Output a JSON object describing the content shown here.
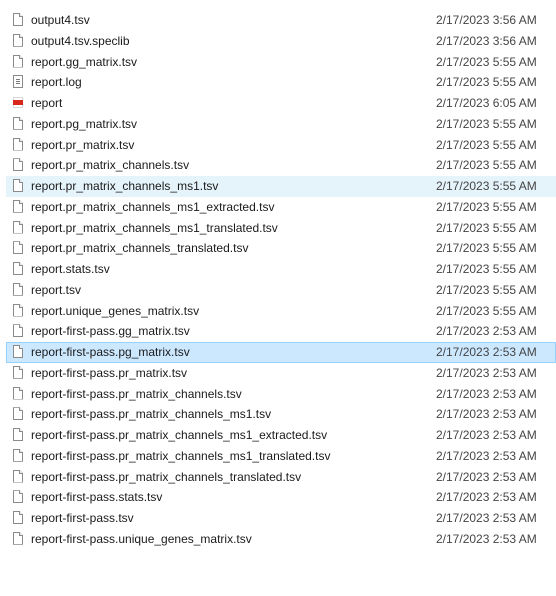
{
  "files": [
    {
      "name": "output4.tsv",
      "modified": "2/17/2023 3:56 AM",
      "icon": "file-icon",
      "state": "normal"
    },
    {
      "name": "output4.tsv.speclib",
      "modified": "2/17/2023 3:56 AM",
      "icon": "file-icon",
      "state": "normal"
    },
    {
      "name": "report.gg_matrix.tsv",
      "modified": "2/17/2023 5:55 AM",
      "icon": "file-icon",
      "state": "normal"
    },
    {
      "name": "report.log",
      "modified": "2/17/2023 5:55 AM",
      "icon": "text-file-icon",
      "state": "normal"
    },
    {
      "name": "report",
      "modified": "2/17/2023 6:05 AM",
      "icon": "pdf-icon",
      "state": "normal"
    },
    {
      "name": "report.pg_matrix.tsv",
      "modified": "2/17/2023 5:55 AM",
      "icon": "file-icon",
      "state": "normal"
    },
    {
      "name": "report.pr_matrix.tsv",
      "modified": "2/17/2023 5:55 AM",
      "icon": "file-icon",
      "state": "normal"
    },
    {
      "name": "report.pr_matrix_channels.tsv",
      "modified": "2/17/2023 5:55 AM",
      "icon": "file-icon",
      "state": "normal"
    },
    {
      "name": "report.pr_matrix_channels_ms1.tsv",
      "modified": "2/17/2023 5:55 AM",
      "icon": "file-icon",
      "state": "hover"
    },
    {
      "name": "report.pr_matrix_channels_ms1_extracted.tsv",
      "modified": "2/17/2023 5:55 AM",
      "icon": "file-icon",
      "state": "normal"
    },
    {
      "name": "report.pr_matrix_channels_ms1_translated.tsv",
      "modified": "2/17/2023 5:55 AM",
      "icon": "file-icon",
      "state": "normal"
    },
    {
      "name": "report.pr_matrix_channels_translated.tsv",
      "modified": "2/17/2023 5:55 AM",
      "icon": "file-icon",
      "state": "normal"
    },
    {
      "name": "report.stats.tsv",
      "modified": "2/17/2023 5:55 AM",
      "icon": "file-icon",
      "state": "normal"
    },
    {
      "name": "report.tsv",
      "modified": "2/17/2023 5:55 AM",
      "icon": "file-icon",
      "state": "normal"
    },
    {
      "name": "report.unique_genes_matrix.tsv",
      "modified": "2/17/2023 5:55 AM",
      "icon": "file-icon",
      "state": "normal"
    },
    {
      "name": "report-first-pass.gg_matrix.tsv",
      "modified": "2/17/2023 2:53 AM",
      "icon": "file-icon",
      "state": "normal"
    },
    {
      "name": "report-first-pass.pg_matrix.tsv",
      "modified": "2/17/2023 2:53 AM",
      "icon": "file-icon",
      "state": "selected"
    },
    {
      "name": "report-first-pass.pr_matrix.tsv",
      "modified": "2/17/2023 2:53 AM",
      "icon": "file-icon",
      "state": "normal"
    },
    {
      "name": "report-first-pass.pr_matrix_channels.tsv",
      "modified": "2/17/2023 2:53 AM",
      "icon": "file-icon",
      "state": "normal"
    },
    {
      "name": "report-first-pass.pr_matrix_channels_ms1.tsv",
      "modified": "2/17/2023 2:53 AM",
      "icon": "file-icon",
      "state": "normal"
    },
    {
      "name": "report-first-pass.pr_matrix_channels_ms1_extracted.tsv",
      "modified": "2/17/2023 2:53 AM",
      "icon": "file-icon",
      "state": "normal"
    },
    {
      "name": "report-first-pass.pr_matrix_channels_ms1_translated.tsv",
      "modified": "2/17/2023 2:53 AM",
      "icon": "file-icon",
      "state": "normal"
    },
    {
      "name": "report-first-pass.pr_matrix_channels_translated.tsv",
      "modified": "2/17/2023 2:53 AM",
      "icon": "file-icon",
      "state": "normal"
    },
    {
      "name": "report-first-pass.stats.tsv",
      "modified": "2/17/2023 2:53 AM",
      "icon": "file-icon",
      "state": "normal"
    },
    {
      "name": "report-first-pass.tsv",
      "modified": "2/17/2023 2:53 AM",
      "icon": "file-icon",
      "state": "normal"
    },
    {
      "name": "report-first-pass.unique_genes_matrix.tsv",
      "modified": "2/17/2023 2:53 AM",
      "icon": "file-icon",
      "state": "normal"
    }
  ],
  "colors": {
    "hover_background": "#e5f3fb",
    "selected_background": "#cce8ff",
    "selected_border": "#99d1ff",
    "pdf_red": "#d9261c"
  }
}
